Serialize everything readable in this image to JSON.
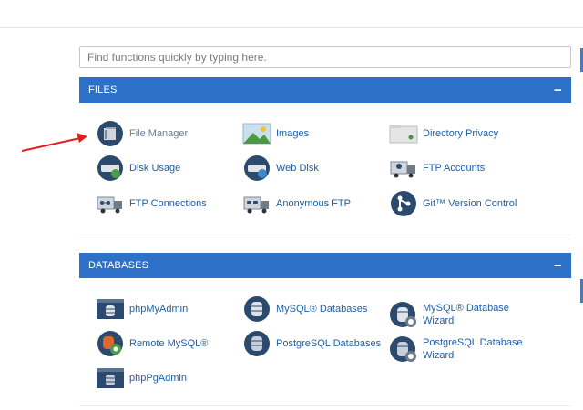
{
  "search": {
    "placeholder": "Find functions quickly by typing here."
  },
  "files": {
    "title": "FILES",
    "collapse": "−",
    "items": [
      {
        "label": "File Manager",
        "icon": "file-manager-icon"
      },
      {
        "label": "Images",
        "icon": "images-icon"
      },
      {
        "label": "Directory Privacy",
        "icon": "directory-privacy-icon"
      },
      {
        "label": "Disk Usage",
        "icon": "disk-usage-icon"
      },
      {
        "label": "Web Disk",
        "icon": "web-disk-icon"
      },
      {
        "label": "FTP Accounts",
        "icon": "ftp-accounts-icon"
      },
      {
        "label": "FTP Connections",
        "icon": "ftp-connections-icon"
      },
      {
        "label": "Anonymous FTP",
        "icon": "anonymous-ftp-icon"
      },
      {
        "label": "Git™ Version Control",
        "icon": "git-icon"
      }
    ]
  },
  "databases": {
    "title": "DATABASES",
    "collapse": "−",
    "items": [
      {
        "label": "phpMyAdmin",
        "icon": "phpmyadmin-icon"
      },
      {
        "label": "MySQL® Databases",
        "icon": "mysql-databases-icon"
      },
      {
        "label": "MySQL® Database Wizard",
        "icon": "mysql-wizard-icon"
      },
      {
        "label": "Remote MySQL®",
        "icon": "remote-mysql-icon"
      },
      {
        "label": "PostgreSQL Databases",
        "icon": "postgresql-databases-icon"
      },
      {
        "label": "PostgreSQL Database Wizard",
        "icon": "postgresql-wizard-icon"
      },
      {
        "label": "phpPgAdmin",
        "icon": "phppgadmin-icon"
      }
    ]
  },
  "colors": {
    "header": "#2d70c8",
    "link": "#1d5fa8",
    "arrow": "#e02020"
  }
}
